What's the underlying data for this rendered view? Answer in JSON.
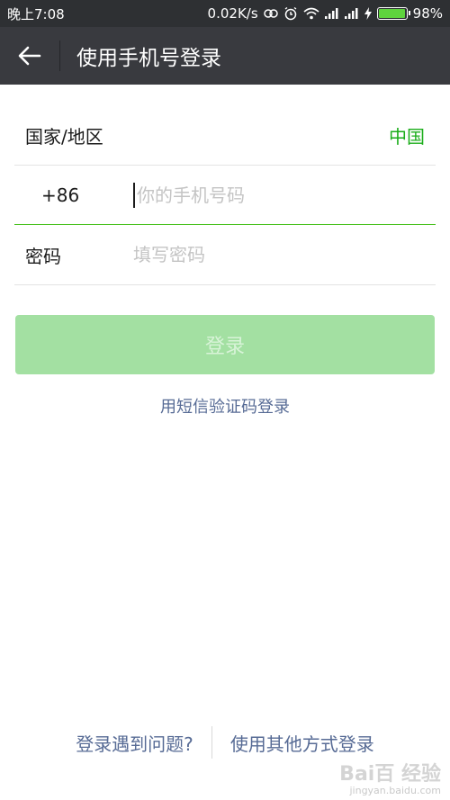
{
  "status_bar": {
    "time": "晚上7:08",
    "network_speed": "0.02K/s",
    "battery": "98%",
    "battery_level": 0.98
  },
  "header": {
    "title": "使用手机号登录",
    "back_icon": "arrow-left-icon"
  },
  "form": {
    "country_label": "国家/地区",
    "country_value": "中国",
    "country_code": "+86",
    "phone_placeholder": "你的手机号码",
    "password_label": "密码",
    "password_placeholder": "填写密码"
  },
  "actions": {
    "login_label": "登录",
    "sms_login_label": "用短信验证码登录"
  },
  "footer": {
    "problem_label": "登录遇到问题?",
    "other_methods_label": "使用其他方式登录"
  },
  "watermark": {
    "logo": "Bai百 经验",
    "url": "jingyan.baidu.com"
  },
  "colors": {
    "accent": "#1aad19",
    "link": "#576b95",
    "title_bar": "#393a3f",
    "login_disabled": "#a3e0a2"
  }
}
